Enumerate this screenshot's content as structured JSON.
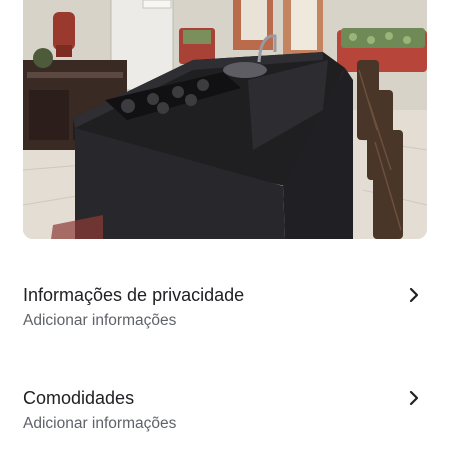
{
  "photo": {
    "icon": "kitchen-photo"
  },
  "sections": [
    {
      "title": "Informações de privacidade",
      "subtitle": "Adicionar informações",
      "icon": "chevron-right-icon"
    },
    {
      "title": "Comodidades",
      "subtitle": "Adicionar informações",
      "icon": "chevron-right-icon"
    }
  ],
  "colors": {
    "title_text": "#202124",
    "subtitle_text": "#5f6368",
    "background": "#ffffff"
  }
}
